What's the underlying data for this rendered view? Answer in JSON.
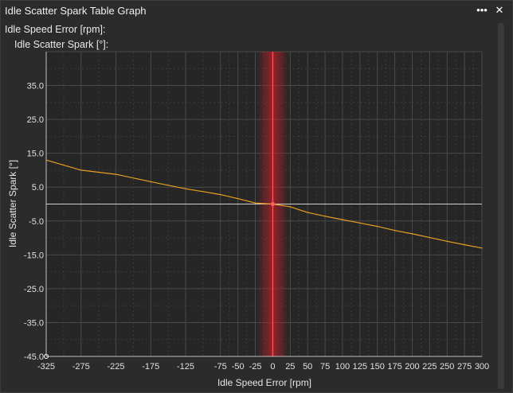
{
  "window": {
    "title": "Idle Scatter Spark Table Graph",
    "menu_icon": "more-icon",
    "close_icon": "close-icon",
    "menu_glyph": "•••",
    "close_glyph": "✕"
  },
  "readouts": {
    "x_readout": "Idle Speed Error [rpm]:",
    "y_readout": "Idle Scatter Spark [°]:"
  },
  "colors": {
    "background": "#2b2b2b",
    "plot_background": "#262626",
    "grid": "#4a4a4a",
    "series": "#e8a020",
    "cursor_band": "#c0202a",
    "zero_line": "#cfcfcf"
  },
  "chart_data": {
    "type": "line",
    "xlabel": "Idle Speed Error [rpm]",
    "ylabel": "Idle Scatter Spark [°]",
    "xlim": [
      -325,
      300
    ],
    "ylim": [
      -45,
      45
    ],
    "x_ticks": [
      -325,
      -275,
      -225,
      -175,
      -125,
      -75,
      -50,
      -25,
      0,
      25,
      50,
      75,
      100,
      125,
      150,
      175,
      200,
      225,
      250,
      275,
      300
    ],
    "x_tick_labels": [
      "-325",
      "-275",
      "-225",
      "-175",
      "-125",
      "-75",
      "-50",
      "-25",
      "0",
      "25",
      "50",
      "75",
      "100",
      "125",
      "150",
      "175",
      "200",
      "225",
      "250",
      "275",
      "300"
    ],
    "y_ticks": [
      -45,
      -35,
      -25,
      -15,
      -5,
      5,
      15,
      25,
      35
    ],
    "y_tick_labels": [
      "-45.0",
      "-35.0",
      "-25.0",
      "-15.0",
      "-5.0",
      "5.0",
      "15.0",
      "25.0",
      "35.0"
    ],
    "grid": true,
    "cursor_x": 0,
    "series": [
      {
        "x": [
          -325,
          -275,
          -225,
          -175,
          -125,
          -100,
          -75,
          -50,
          -25,
          0,
          25,
          50,
          75,
          100,
          125,
          150,
          175,
          200,
          225,
          250,
          275,
          300
        ],
        "y": [
          13,
          10,
          8.8,
          6.6,
          4.5,
          3.7,
          2.8,
          1.6,
          0.3,
          0,
          -0.8,
          -2.5,
          -3.6,
          -4.6,
          -5.6,
          -6.6,
          -7.8,
          -8.8,
          -9.9,
          -11,
          -12,
          -13
        ]
      }
    ]
  }
}
